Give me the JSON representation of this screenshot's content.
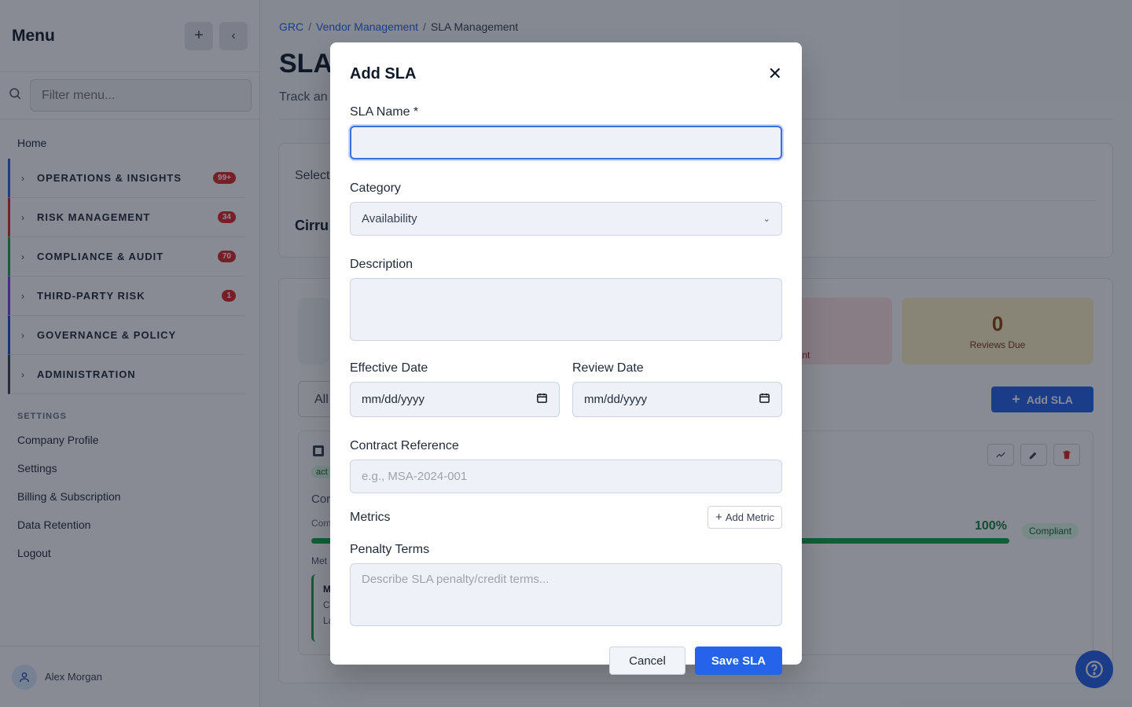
{
  "sidebar": {
    "title": "Menu",
    "filter_placeholder": "Filter menu...",
    "home": "Home",
    "groups": [
      {
        "label": "OPERATIONS & INSIGHTS",
        "badge": "99+",
        "color": "#2563eb"
      },
      {
        "label": "RISK MANAGEMENT",
        "badge": "34",
        "color": "#dc2626"
      },
      {
        "label": "COMPLIANCE & AUDIT",
        "badge": "70",
        "color": "#16a34a"
      },
      {
        "label": "THIRD-PARTY RISK",
        "badge": "1",
        "color": "#7c3aed"
      },
      {
        "label": "GOVERNANCE & POLICY",
        "badge": "",
        "color": "#1d4ed8"
      },
      {
        "label": "ADMINISTRATION",
        "badge": "",
        "color": "#374151"
      }
    ],
    "settings_heading": "SETTINGS",
    "links": [
      "Company Profile",
      "Settings",
      "Billing & Subscription",
      "Data Retention",
      "Logout"
    ],
    "user": "Alex Morgan"
  },
  "breadcrumb": {
    "root": "GRC",
    "parent": "Vendor Management",
    "current": "SLA Management"
  },
  "page": {
    "title": "SLA",
    "subtitle": "Track an",
    "select_label": "Select",
    "vendor_partial": "Cirru",
    "stat_noncompliant_label": "npliant",
    "stat_reviews_value": "0",
    "stat_reviews_label": "Reviews Due",
    "filter_all": "All",
    "add_sla": "Add SLA",
    "sla_status_tag": "act",
    "sla_row1": "Cor",
    "sla_row2": "Com",
    "metrics_label": "Met",
    "metric_partial": "M",
    "metric_line2": "C",
    "metric_line3": "La",
    "percent": "100%",
    "compliant": "Compliant",
    "compliance_value": 1.0
  },
  "modal": {
    "title": "Add SLA",
    "sla_name_label": "SLA Name *",
    "sla_name_value": "",
    "category_label": "Category",
    "category_value": "Availability",
    "description_label": "Description",
    "effective_date_label": "Effective Date",
    "effective_date_placeholder": "mm/dd/yyyy",
    "review_date_label": "Review Date",
    "review_date_placeholder": "mm/dd/yyyy",
    "contract_label": "Contract Reference",
    "contract_placeholder": "e.g., MSA-2024-001",
    "metrics_label": "Metrics",
    "add_metric": "Add Metric",
    "penalty_label": "Penalty Terms",
    "penalty_placeholder": "Describe SLA penalty/credit terms...",
    "cancel": "Cancel",
    "save": "Save SLA"
  }
}
